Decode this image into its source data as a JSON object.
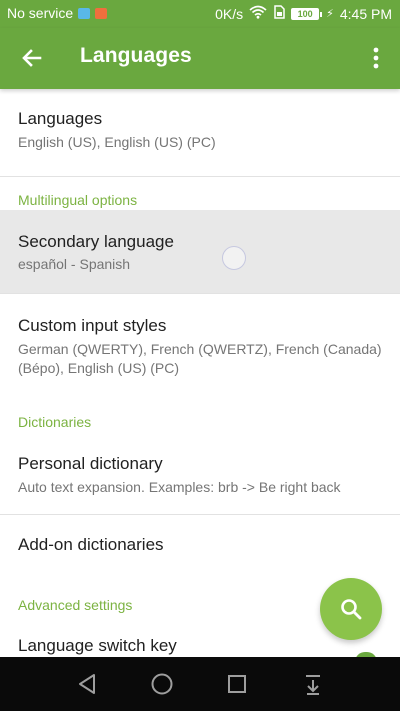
{
  "status_bar": {
    "carrier": "No service",
    "data_speed": "0K/s",
    "battery_level": "100",
    "time": "4:45 PM",
    "icons": [
      "notification-app-icon",
      "notification-media-icon",
      "wifi-icon",
      "sim-icon",
      "battery-icon",
      "charging-icon"
    ]
  },
  "app_bar": {
    "title": "Languages",
    "back_icon": "arrow-left-icon",
    "menu_icon": "more-vertical-icon"
  },
  "settings": {
    "languages": {
      "title": "Languages",
      "summary": "English (US), English (US) (PC)"
    },
    "multilingual_header": "Multilingual options",
    "secondary_language": {
      "title": "Secondary language",
      "summary": "español - Spanish"
    },
    "custom_input_styles": {
      "title": "Custom input styles",
      "summary": "German (QWERTY), French (QWERTZ), French (Canada) (Bépo), English (US) (PC)"
    },
    "dictionaries_header": "Dictionaries",
    "personal_dictionary": {
      "title": "Personal dictionary",
      "summary": "Auto text expansion. Examples: brb -> Be right back"
    },
    "addon_dictionaries": {
      "title": "Add-on dictionaries"
    },
    "advanced_header": "Advanced settings",
    "language_switch_key": {
      "title": "Language switch key"
    }
  },
  "fab": {
    "icon": "search-icon"
  },
  "nav": {
    "back_icon": "triangle-back-icon",
    "home_icon": "circle-home-icon",
    "recents_icon": "square-recents-icon",
    "notifications_icon": "pull-down-icon"
  },
  "colors": {
    "primary": "#6aa83f",
    "accent": "#8bc34a",
    "section_header": "#7cb342",
    "pressed_row": "#e8e8e8"
  }
}
